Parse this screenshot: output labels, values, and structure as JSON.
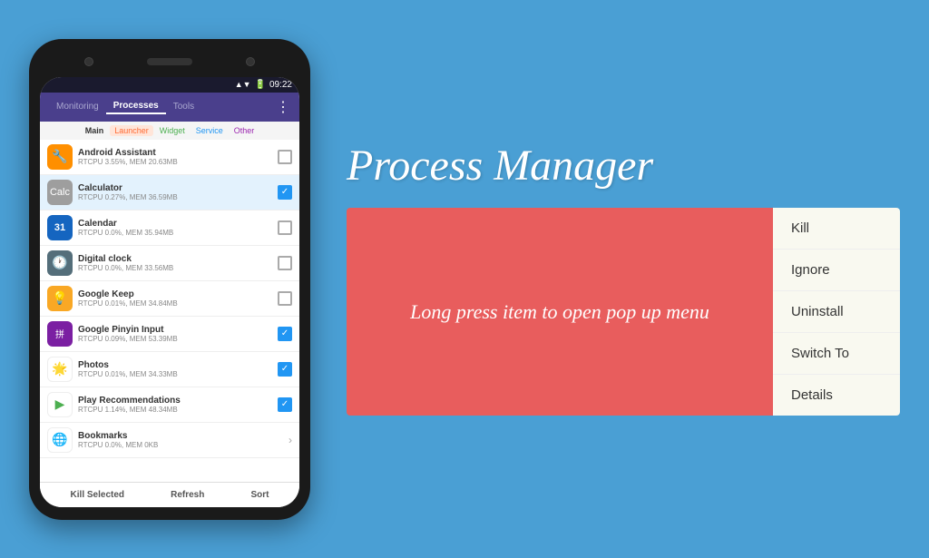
{
  "app_title": "Process Manager",
  "background_color": "#4A9FD4",
  "phone": {
    "status_bar": {
      "time": "09:22",
      "signal": "▲▼",
      "battery": "🔋"
    },
    "nav": {
      "items": [
        {
          "label": "Monitoring",
          "active": false
        },
        {
          "label": "Processes",
          "active": true
        },
        {
          "label": "Tools",
          "active": false
        }
      ]
    },
    "tabs": [
      {
        "label": "Main",
        "style": "main"
      },
      {
        "label": "Launcher",
        "style": "launcher"
      },
      {
        "label": "Widget",
        "style": "widget"
      },
      {
        "label": "Service",
        "style": "service"
      },
      {
        "label": "Other",
        "style": "other"
      }
    ],
    "processes": [
      {
        "name": "Android Assistant",
        "stats": "RTCPU 3.55%, MEM 20.63MB",
        "checked": false,
        "icon": "🔧",
        "icon_class": "icon-android"
      },
      {
        "name": "Calculator",
        "stats": "RTCPU 0.27%, MEM 36.59MB",
        "checked": true,
        "icon": "🧮",
        "icon_class": "icon-calculator"
      },
      {
        "name": "Calendar",
        "stats": "RTCPU 0.0%, MEM 35.94MB",
        "checked": false,
        "icon": "31",
        "icon_class": "icon-calendar"
      },
      {
        "name": "Digital clock",
        "stats": "RTCPU 0.0%, MEM 33.56MB",
        "checked": false,
        "icon": "🕐",
        "icon_class": "icon-clock"
      },
      {
        "name": "Google Keep",
        "stats": "RTCPU 0.01%, MEM 34.84MB",
        "checked": false,
        "icon": "💡",
        "icon_class": "icon-keep"
      },
      {
        "name": "Google Pinyin Input",
        "stats": "RTCPU 0.09%, MEM 53.39MB",
        "checked": true,
        "icon": "⌨",
        "icon_class": "icon-pinyin"
      },
      {
        "name": "Photos",
        "stats": "RTCPU 0.01%, MEM 34.33MB",
        "checked": true,
        "icon": "🌟",
        "icon_class": "icon-photos"
      },
      {
        "name": "Play Recommendations",
        "stats": "RTCPU 1.14%, MEM 48.34MB",
        "checked": true,
        "icon": "▶",
        "icon_class": "icon-play"
      },
      {
        "name": "Bookmarks",
        "stats": "RTCPU 0.0%, MEM 0KB",
        "checked": false,
        "icon": "🌐",
        "icon_class": "icon-bookmarks",
        "chevron": true
      }
    ],
    "bottom_bar": {
      "kill_selected": "Kill Selected",
      "refresh": "Refresh",
      "sort": "Sort"
    }
  },
  "right": {
    "title_line1": "Process Manager",
    "popup_prompt": "Long press item to open pop up menu",
    "menu_items": [
      {
        "label": "Kill"
      },
      {
        "label": "Ignore"
      },
      {
        "label": "Uninstall"
      },
      {
        "label": "Switch To"
      },
      {
        "label": "Details"
      }
    ]
  }
}
